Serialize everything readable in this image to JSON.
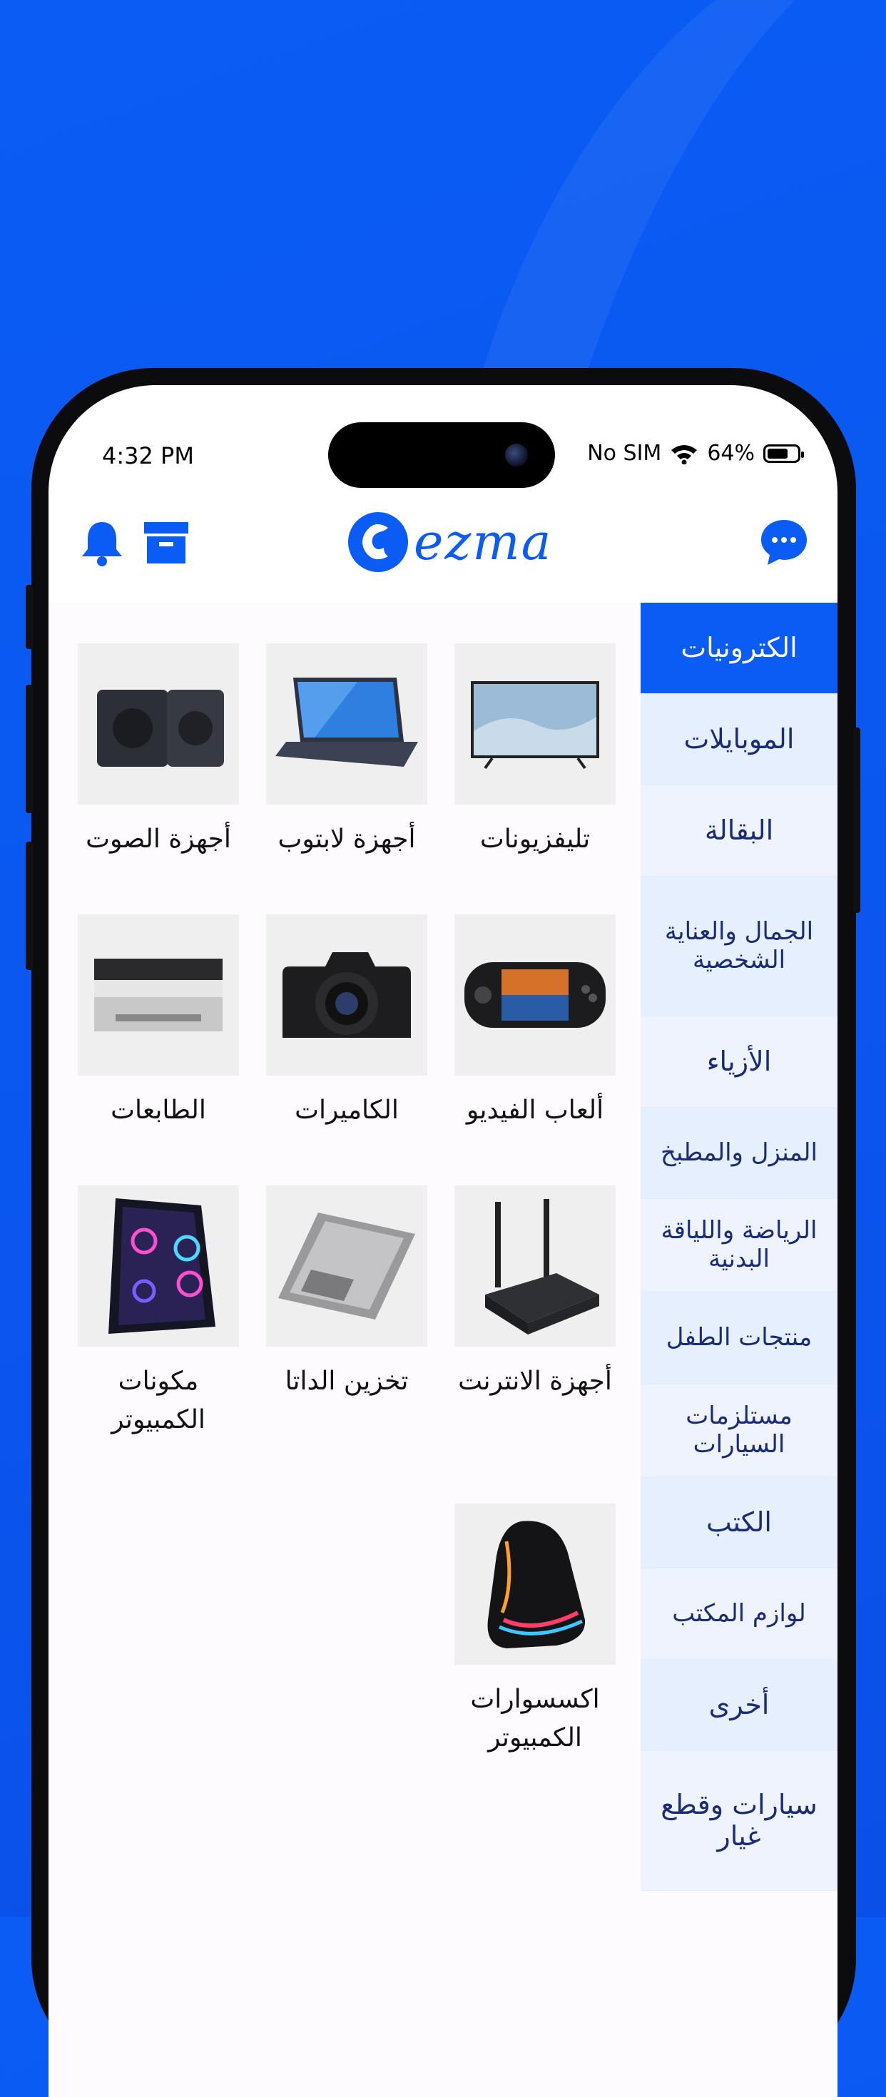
{
  "status_bar": {
    "time": "4:32 PM",
    "carrier": "No SIM",
    "battery": "64%",
    "battery_level": 0.64
  },
  "header": {
    "logo_text": "ezma",
    "icons": {
      "chat": "chat-icon",
      "archive": "archive-box-icon",
      "bell": "bell-icon"
    }
  },
  "sidebar": {
    "items": [
      {
        "label": "الكترونيات",
        "active": true
      },
      {
        "label": "الموبايلات"
      },
      {
        "label": "البقالة"
      },
      {
        "label": "الجمال والعناية الشخصية"
      },
      {
        "label": "الأزياء"
      },
      {
        "label": "المنزل والمطبخ"
      },
      {
        "label": "الرياضة واللياقة البدنية"
      },
      {
        "label": "منتجات الطفل"
      },
      {
        "label": "مستلزمات السيارات"
      },
      {
        "label": "الكتب"
      },
      {
        "label": "لوازم المكتب"
      },
      {
        "label": "أخرى"
      },
      {
        "label": "سيارات وقطع غيار"
      }
    ]
  },
  "categories": [
    {
      "label": "تليفزيونات",
      "icon": "tv-image"
    },
    {
      "label": "أجهزة لابتوب",
      "icon": "laptop-image"
    },
    {
      "label": "أجهزة الصوت",
      "icon": "speakers-image"
    },
    {
      "label": "ألعاب الفيديو",
      "icon": "handheld-console-image"
    },
    {
      "label": "الكاميرات",
      "icon": "camera-image"
    },
    {
      "label": "الطابعات",
      "icon": "printer-image"
    },
    {
      "label": "أجهزة الانترنت",
      "icon": "router-image"
    },
    {
      "label": "تخزين الداتا",
      "icon": "hard-drive-image"
    },
    {
      "label": "مكونات الكمبيوتر",
      "icon": "pc-case-image"
    },
    {
      "label": "اكسسوارات الكمبيوتر",
      "icon": "mouse-image"
    }
  ],
  "colors": {
    "brand": "#0a5cf5",
    "sidebar_text": "#1a2b78",
    "sidebar_bg": "#e6effd"
  }
}
